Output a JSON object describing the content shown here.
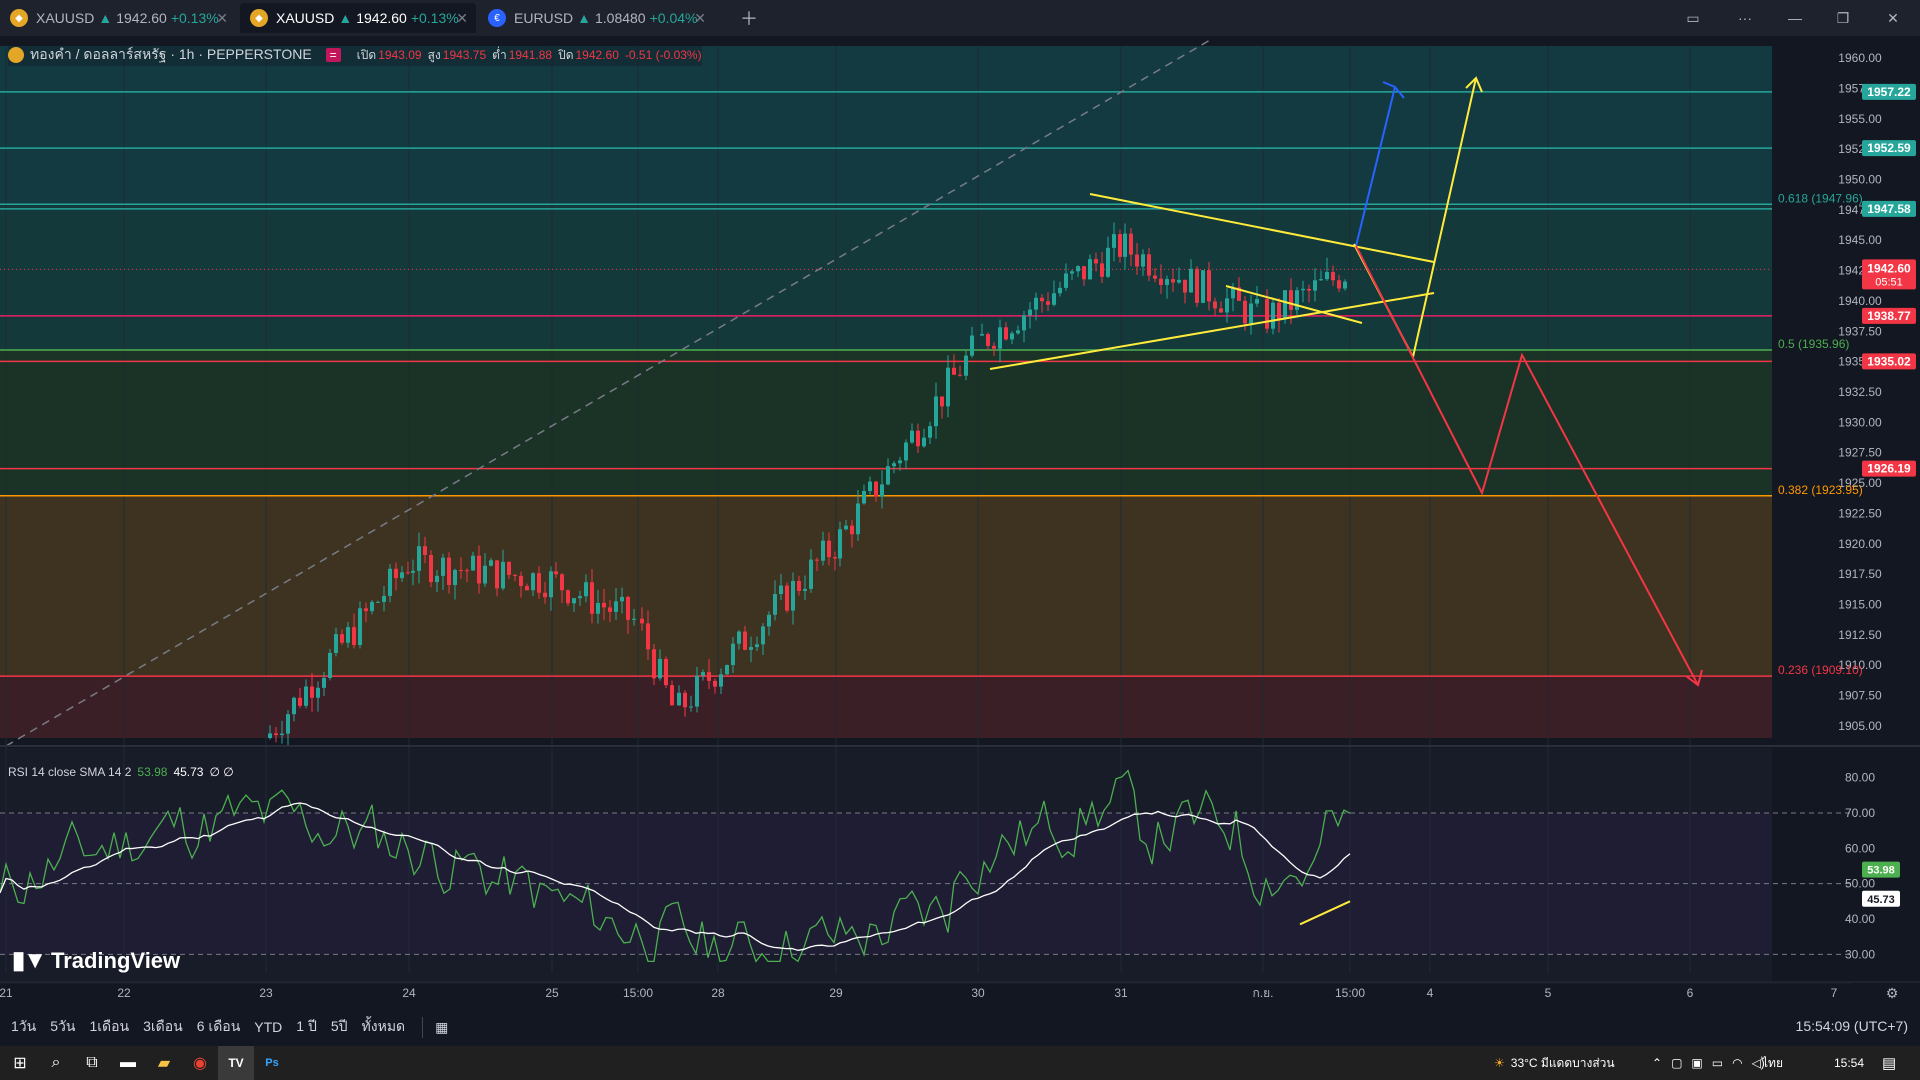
{
  "tabs": [
    {
      "symbol": "XAUUSD",
      "price": "1942.60",
      "change": "+0.13%"
    },
    {
      "symbol": "XAUUSD",
      "price": "1942.60",
      "change": "+0.13%"
    },
    {
      "symbol": "EURUSD",
      "price": "1.08480",
      "change": "+0.04%"
    }
  ],
  "legend": {
    "title": "ทองคำ / ดอลลาร์สหรัฐ · 1h · PEPPERSTONE",
    "open_label": "เปิด",
    "open": "1943.09",
    "high_label": "สูง",
    "high": "1943.75",
    "low_label": "ต่ำ",
    "low": "1941.88",
    "close_label": "ปิด",
    "close": "1942.60",
    "change": "-0.51 (-0.03%)"
  },
  "price_axis": {
    "ticks": [
      "1960.00",
      "1957.50",
      "1955.00",
      "1952.50",
      "1950.00",
      "1947.50",
      "1945.00",
      "1942.50",
      "1940.00",
      "1937.50",
      "1935.00",
      "1932.50",
      "1930.00",
      "1927.50",
      "1925.00",
      "1922.50",
      "1920.00",
      "1917.50",
      "1915.00",
      "1912.50",
      "1910.00",
      "1907.50",
      "1905.00"
    ],
    "labels": [
      {
        "price": 1957.22,
        "text": "1957.22",
        "color": "#26a69a"
      },
      {
        "price": 1952.59,
        "text": "1952.59",
        "color": "#26a69a"
      },
      {
        "price": 1947.58,
        "text": "1947.58",
        "color": "#26a69a"
      },
      {
        "price": 1938.77,
        "text": "1938.77",
        "color": "#f23645"
      },
      {
        "price": 1935.02,
        "text": "1935.02",
        "color": "#f23645"
      },
      {
        "price": 1926.19,
        "text": "1926.19",
        "color": "#f23645"
      }
    ],
    "current_price": "1942.60",
    "countdown": "05:51"
  },
  "fib_labels": [
    {
      "price": 1947.96,
      "text": "0.618 (1947.96)",
      "color": "#26a69a"
    },
    {
      "price": 1935.96,
      "text": "0.5 (1935.96)",
      "color": "#4caf50"
    },
    {
      "price": 1923.95,
      "text": "0.382 (1923.95)",
      "color": "#ff9800"
    },
    {
      "price": 1909.1,
      "text": "0.236 (1909.10)",
      "color": "#f23645"
    }
  ],
  "rsi": {
    "legend": "RSI 14 close SMA 14 2",
    "rsi_value": "53.98",
    "sma_value": "45.73",
    "extra": "∅ ∅",
    "ticks": [
      "80.00",
      "70.00",
      "60.00",
      "50.00",
      "40.00",
      "30.00"
    ]
  },
  "time_axis": [
    "21",
    "22",
    "23",
    "24",
    "25",
    "15:00",
    "28",
    "29",
    "30",
    "31",
    "ก.ย.",
    "15:00",
    "4",
    "5",
    "6",
    "7"
  ],
  "branding": "TradingView",
  "toolbar": {
    "ranges": [
      "1วัน",
      "5วัน",
      "1เดือน",
      "3เดือน",
      "6 เดือน",
      "YTD",
      "1 ปี",
      "5ปี",
      "ทั้งหมด"
    ],
    "clock": "15:54:09 (UTC+7)"
  },
  "taskbar": {
    "weather": "33°C  มีแดดบางส่วน",
    "language": "ไทย",
    "time": "15:54"
  },
  "chart_data": {
    "type": "candlestick",
    "symbol": "XAUUSD",
    "interval": "1h",
    "ylim": [
      1904,
      1961
    ],
    "horizontal_levels": [
      1957.22,
      1952.59,
      1947.58,
      1947.96,
      1938.77,
      1935.96,
      1935.02,
      1926.19,
      1923.95,
      1909.1
    ],
    "close_path_approx": [
      {
        "x": "23",
        "y": 1904.0
      },
      {
        "x": "24",
        "y": 1918.5
      },
      {
        "x": "25",
        "y": 1917.0
      },
      {
        "x": "15:00",
        "y": 1913.5
      },
      {
        "x": "28",
        "y": 1906.0
      },
      {
        "x": "29",
        "y": 1920.0
      },
      {
        "x": "30",
        "y": 1936.5
      },
      {
        "x": "31",
        "y": 1944.5
      },
      {
        "x": "ก.ย.",
        "y": 1938.5
      },
      {
        "x": "15:00",
        "y": 1942.6
      }
    ],
    "rsi_ylim": [
      25,
      85
    ]
  }
}
